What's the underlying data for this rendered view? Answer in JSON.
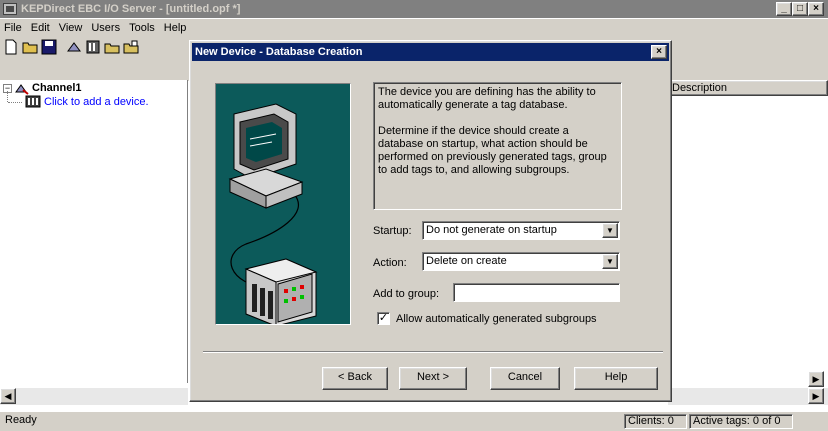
{
  "main_window": {
    "title": "KEPDirect EBC I/O Server - [untitled.opf *]",
    "buttons": {
      "minimize": "_",
      "maximize": "□",
      "close": "×"
    }
  },
  "menu": [
    "File",
    "Edit",
    "View",
    "Users",
    "Tools",
    "Help"
  ],
  "toolbar_icons": [
    "new-icon",
    "open-icon",
    "save-icon",
    "new-channel-icon",
    "new-device-icon",
    "new-group-icon",
    "new-tag-icon"
  ],
  "tree": {
    "channel": "Channel1",
    "add_device": "Click to add a device."
  },
  "grid": {
    "columns": [
      "Description"
    ]
  },
  "statusbar": {
    "ready": "Ready",
    "clients": "Clients: 0",
    "active_tags": "Active tags: 0 of 0"
  },
  "dialog": {
    "title": "New Device - Database Creation",
    "close": "×",
    "description_p1": "The device you are defining has the ability to automatically generate a tag database.",
    "description_p2": "Determine if the device should create a database on startup, what action should be performed on previously generated tags, group to add tags to, and allowing subgroups.",
    "startup_label": "Startup:",
    "startup_value": "Do not generate on startup",
    "action_label": "Action:",
    "action_value": "Delete on create",
    "group_label": "Add to group:",
    "group_value": "",
    "subgroups_label": "Allow automatically generated subgroups",
    "subgroups_checked": true,
    "buttons": {
      "back": "< Back",
      "next": "Next >",
      "cancel": "Cancel",
      "help": "Help"
    }
  }
}
